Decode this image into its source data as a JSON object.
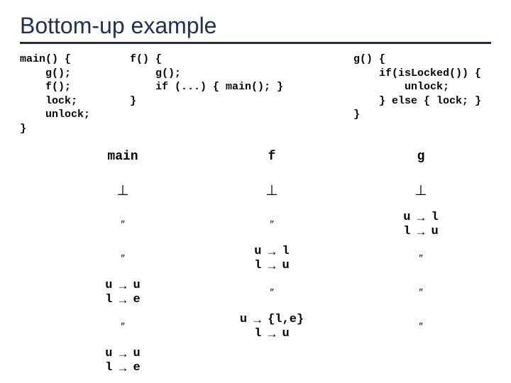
{
  "title": "Bottom-up example",
  "code": {
    "main": "main() {\n    g();\n    f();\n    lock;\n    unlock;\n}",
    "f": "f() {\n    g();\n    if (...) { main(); }\n}",
    "g": "g() {\n    if(isLocked()) {\n        unlock;\n    } else { lock; }\n}"
  },
  "headers": {
    "main": "main",
    "f": "f",
    "g": "g"
  },
  "symbols": {
    "bottom": "⊥",
    "ditto": "″",
    "arrow": "→"
  },
  "rows": [
    {
      "main": {
        "type": "bot"
      },
      "f": {
        "type": "bot"
      },
      "g": {
        "type": "bot"
      }
    },
    {
      "main": {
        "type": "ditto"
      },
      "f": {
        "type": "ditto"
      },
      "g": {
        "type": "map",
        "lines": [
          [
            "u",
            "l"
          ],
          [
            "l",
            "u"
          ]
        ]
      }
    },
    {
      "main": {
        "type": "ditto"
      },
      "f": {
        "type": "map",
        "lines": [
          [
            "u",
            "l"
          ],
          [
            "l",
            "u"
          ]
        ]
      },
      "g": {
        "type": "ditto"
      }
    },
    {
      "main": {
        "type": "map",
        "lines": [
          [
            "u",
            "u"
          ],
          [
            "l",
            "e"
          ]
        ]
      },
      "f": {
        "type": "ditto"
      },
      "g": {
        "type": "ditto"
      }
    },
    {
      "main": {
        "type": "ditto"
      },
      "f": {
        "type": "map",
        "lines": [
          [
            "u",
            "{l,e}"
          ],
          [
            "l",
            "u"
          ]
        ]
      },
      "g": {
        "type": "ditto"
      }
    },
    {
      "main": {
        "type": "map",
        "lines": [
          [
            "u",
            "u"
          ],
          [
            "l",
            "e"
          ]
        ]
      },
      "f": {
        "type": "blank"
      },
      "g": {
        "type": "blank"
      }
    }
  ]
}
